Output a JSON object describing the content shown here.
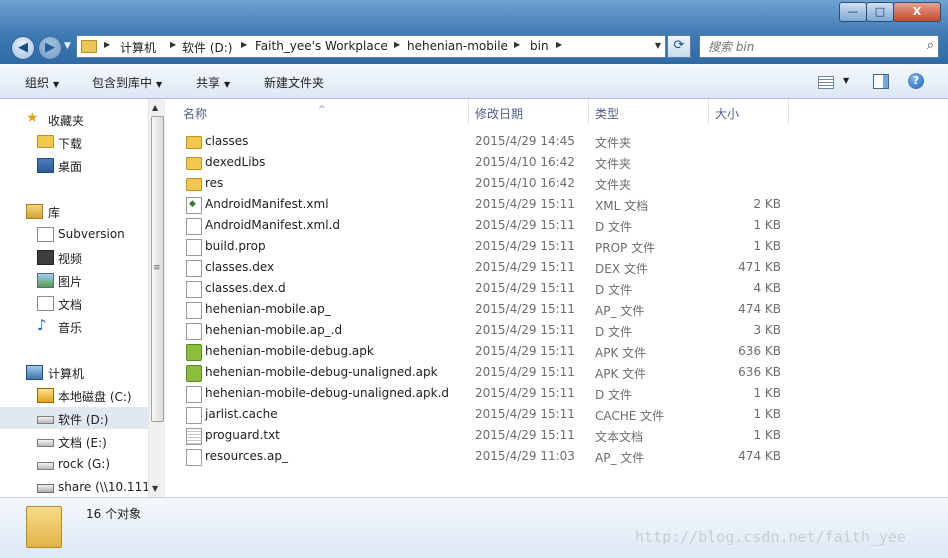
{
  "address": {
    "crumbs": [
      "计算机",
      "软件 (D:)",
      "Faith_yee's Workplace",
      "hehenian-mobile",
      "bin"
    ]
  },
  "search": {
    "placeholder": "搜索 bin"
  },
  "window_controls": {
    "min": "—",
    "max": "□",
    "close": "X"
  },
  "toolbar": {
    "organize": "组织",
    "include_in_library": "包含到库中",
    "share": "共享",
    "new_folder": "新建文件夹"
  },
  "nav": {
    "favorites": {
      "label": "收藏夹",
      "items": [
        "下载",
        "桌面"
      ]
    },
    "libraries": {
      "label": "库",
      "items": [
        "Subversion",
        "视频",
        "图片",
        "文档",
        "音乐"
      ]
    },
    "computer": {
      "label": "计算机",
      "items": [
        "本地磁盘 (C:)",
        "软件 (D:)",
        "文档 (E:)",
        "rock (G:)",
        "share (\\\\10.111"
      ]
    },
    "selected": "软件 (D:)"
  },
  "columns": {
    "name": "名称",
    "date": "修改日期",
    "type": "类型",
    "size": "大小"
  },
  "files": [
    {
      "icon": "folder-icon",
      "name": "classes",
      "date": "2015/4/29 14:45",
      "type": "文件夹",
      "size": ""
    },
    {
      "icon": "folder-icon",
      "name": "dexedLibs",
      "date": "2015/4/10 16:42",
      "type": "文件夹",
      "size": ""
    },
    {
      "icon": "folder-icon",
      "name": "res",
      "date": "2015/4/10 16:42",
      "type": "文件夹",
      "size": ""
    },
    {
      "icon": "xml-file-icon",
      "name": "AndroidManifest.xml",
      "date": "2015/4/29 15:11",
      "type": "XML 文档",
      "size": "2 KB"
    },
    {
      "icon": "file-icon",
      "name": "AndroidManifest.xml.d",
      "date": "2015/4/29 15:11",
      "type": "D 文件",
      "size": "1 KB"
    },
    {
      "icon": "file-icon",
      "name": "build.prop",
      "date": "2015/4/29 15:11",
      "type": "PROP 文件",
      "size": "1 KB"
    },
    {
      "icon": "file-icon",
      "name": "classes.dex",
      "date": "2015/4/29 15:11",
      "type": "DEX 文件",
      "size": "471 KB"
    },
    {
      "icon": "file-icon",
      "name": "classes.dex.d",
      "date": "2015/4/29 15:11",
      "type": "D 文件",
      "size": "4 KB"
    },
    {
      "icon": "file-icon",
      "name": "hehenian-mobile.ap_",
      "date": "2015/4/29 15:11",
      "type": "AP_ 文件",
      "size": "474 KB"
    },
    {
      "icon": "file-icon",
      "name": "hehenian-mobile.ap_.d",
      "date": "2015/4/29 15:11",
      "type": "D 文件",
      "size": "3 KB"
    },
    {
      "icon": "apk-file-icon",
      "name": "hehenian-mobile-debug.apk",
      "date": "2015/4/29 15:11",
      "type": "APK 文件",
      "size": "636 KB"
    },
    {
      "icon": "apk-file-icon",
      "name": "hehenian-mobile-debug-unaligned.apk",
      "date": "2015/4/29 15:11",
      "type": "APK 文件",
      "size": "636 KB"
    },
    {
      "icon": "file-icon",
      "name": "hehenian-mobile-debug-unaligned.apk.d",
      "date": "2015/4/29 15:11",
      "type": "D 文件",
      "size": "1 KB"
    },
    {
      "icon": "file-icon",
      "name": "jarlist.cache",
      "date": "2015/4/29 15:11",
      "type": "CACHE 文件",
      "size": "1 KB"
    },
    {
      "icon": "text-file-icon",
      "name": "proguard.txt",
      "date": "2015/4/29 15:11",
      "type": "文本文档",
      "size": "1 KB"
    },
    {
      "icon": "file-icon",
      "name": "resources.ap_",
      "date": "2015/4/29 11:03",
      "type": "AP_ 文件",
      "size": "474 KB"
    }
  ],
  "details": {
    "count": "16 个对象"
  },
  "watermark": "http://blog.csdn.net/faith_yee"
}
